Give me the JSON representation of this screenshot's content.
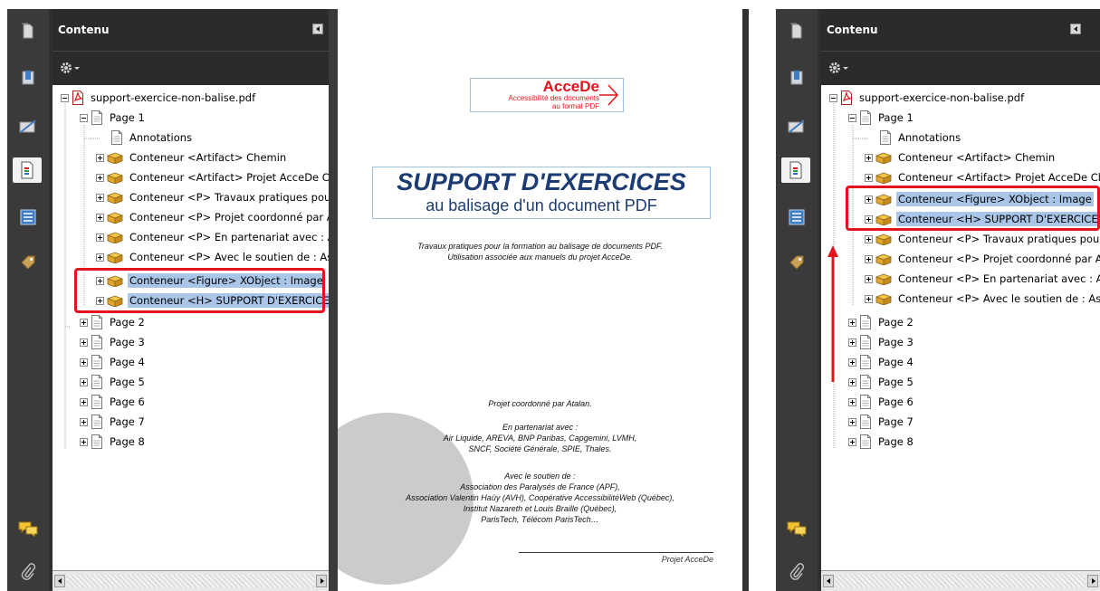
{
  "left_panel": {
    "title": "Contenu",
    "tree": {
      "root": "support-exercice-non-balise.pdf",
      "page1": "Page 1",
      "annotations": "Annotations",
      "items": [
        "Conteneur <Artifact> Chemin",
        "Conteneur <Artifact> Projet AcceDe Cl",
        "Conteneur <P> Travaux pratiques pou",
        "Conteneur <P> Projet coordonné par A",
        "Conteneur <P> En partenariat avec : A",
        "Conteneur <P> Avec le soutien de : As",
        "Conteneur <Figure> XObject :  Image",
        "Conteneur <H> SUPPORT D'EXERCICE"
      ],
      "pages": [
        "Page 2",
        "Page 3",
        "Page 4",
        "Page 5",
        "Page 6",
        "Page 7",
        "Page 8"
      ]
    }
  },
  "right_panel": {
    "title": "Contenu",
    "tree": {
      "root": "support-exercice-non-balise.pdf",
      "page1": "Page 1",
      "annotations": "Annotations",
      "items": [
        "Conteneur <Artifact> Chemin",
        "Conteneur <Artifact> Projet AcceDe Cl",
        "Conteneur <Figure> XObject :  Image",
        "Conteneur <H> SUPPORT D'EXERCICE",
        "Conteneur <P> Travaux pratiques pou",
        "Conteneur <P> Projet coordonné par A",
        "Conteneur <P> En partenariat avec : A",
        "Conteneur <P> Avec le soutien de : As"
      ],
      "pages": [
        "Page 2",
        "Page 3",
        "Page 4",
        "Page 5",
        "Page 6",
        "Page 7",
        "Page 8"
      ]
    }
  },
  "document": {
    "logo_title": "AcceDe",
    "logo_line1": "Accessibilité des documents",
    "logo_line2": "au format PDF",
    "title": "SUPPORT D'EXERCICES",
    "subtitle": "au balisage d'un document PDF",
    "intro_line1": "Travaux pratiques pour la formation au balisage de documents PDF.",
    "intro_line2": "Utilisation associée aux manuels du projet AcceDe.",
    "coord": "Projet coordonné par Atalan.",
    "partner_title": "En partenariat avec :",
    "partner_line1": "Air Liquide, AREVA, BNP Paribas, Capgemini, LVMH,",
    "partner_line2": "SNCF, Société Générale, SPIE, Thales.",
    "support_title": "Avec le soutien de :",
    "support_line1": "Association des Paralysés de France (APF),",
    "support_line2": "Association Valentin Haüy (AVH), Coopérative AccessibilitéWeb (Québec),",
    "support_line3": "Institut Nazareth et Louis Braille (Québec),",
    "support_line4": "ParisTech, Télécom ParisTech…",
    "footer": "Projet AcceDe"
  },
  "colors": {
    "highlight": "#e3141b",
    "selection": "#a9c6e8",
    "title_blue": "#1d3c73",
    "dark_ui": "#2f2f2f"
  }
}
